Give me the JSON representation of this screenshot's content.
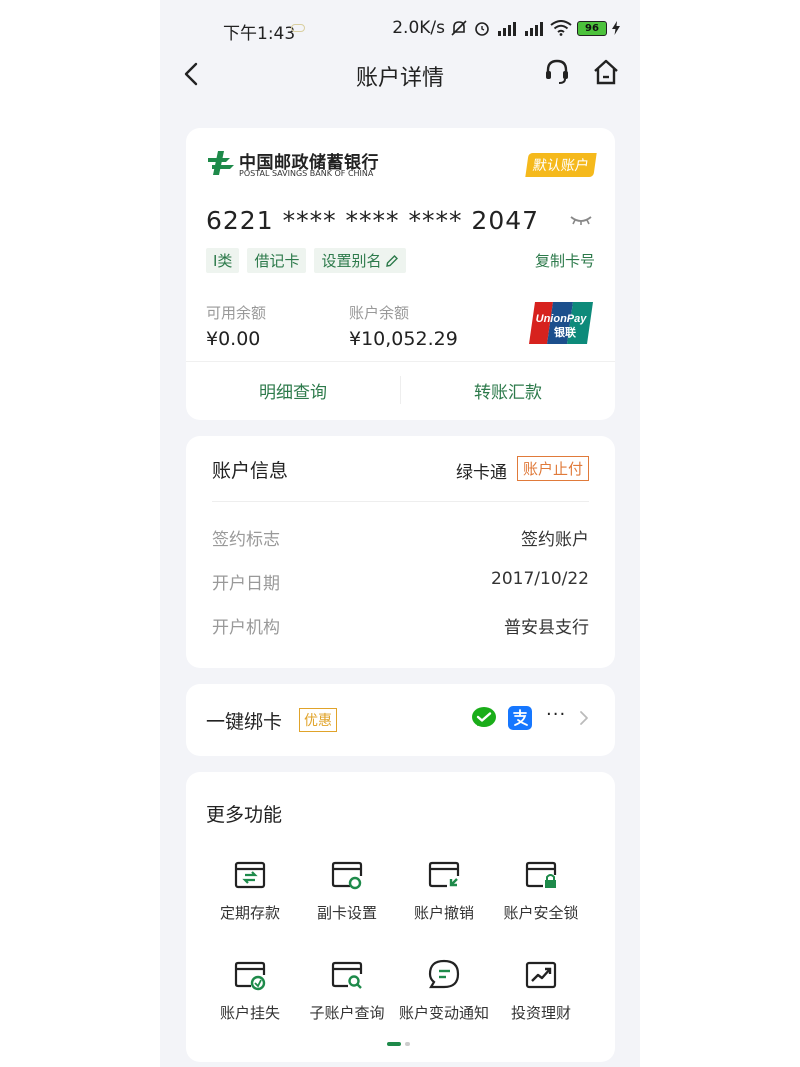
{
  "status_bar": {
    "time": "下午1:43",
    "speed": "2.0K/s",
    "battery": "96"
  },
  "nav": {
    "title": "账户详情"
  },
  "account_card": {
    "bank_name_cn": "中国邮政储蓄银行",
    "bank_name_en": "POSTAL SAVINGS BANK OF CHINA",
    "default_tag": "默认账户",
    "card_number": "6221 **** **** **** 2047",
    "tags": [
      "I类",
      "借记卡",
      "设置别名"
    ],
    "copy_label": "复制卡号",
    "available_label": "可用余额",
    "available_value": "¥0.00",
    "balance_label": "账户余额",
    "balance_value": "¥10,052.29",
    "unionpay_label": "UnionPay",
    "unionpay_cn": "银联",
    "detail_button": "明细查询",
    "transfer_button": "转账汇款"
  },
  "account_info": {
    "title": "账户信息",
    "green_card": "绿卡通",
    "stop_badge": "账户止付",
    "rows": [
      {
        "label": "签约标志",
        "value": "签约账户"
      },
      {
        "label": "开户日期",
        "value": "2017/10/22"
      },
      {
        "label": "开户机构",
        "value": "普安县支行"
      }
    ]
  },
  "bind_card": {
    "label": "一键绑卡",
    "promo": "优惠",
    "more": "···"
  },
  "more_functions": {
    "title": "更多功能",
    "items": [
      {
        "label": "定期存款",
        "icon": "fixed-deposit-icon"
      },
      {
        "label": "副卡设置",
        "icon": "sub-card-settings-icon"
      },
      {
        "label": "账户撤销",
        "icon": "account-cancel-icon"
      },
      {
        "label": "账户安全锁",
        "icon": "account-lock-icon"
      },
      {
        "label": "账户挂失",
        "icon": "report-loss-icon"
      },
      {
        "label": "子账户查询",
        "icon": "sub-account-query-icon"
      },
      {
        "label": "账户变动通知",
        "icon": "change-notice-icon"
      },
      {
        "label": "投资理财",
        "icon": "investment-icon"
      }
    ]
  },
  "colors": {
    "brand_green": "#2d7a4b",
    "default_tag": "#f5b91c",
    "stop_badge": "#e07a3a",
    "promo": "#e0a32a"
  }
}
